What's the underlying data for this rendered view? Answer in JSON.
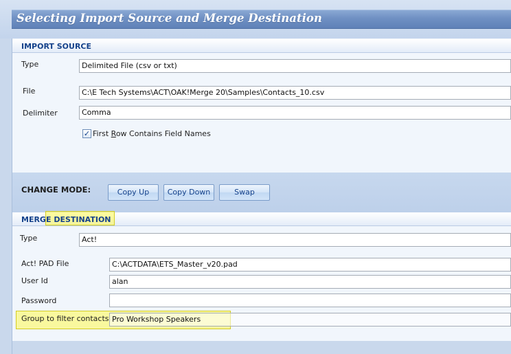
{
  "window": {
    "title": "Selecting Import Source and Merge Destination"
  },
  "import_source": {
    "section_title": "IMPORT SOURCE",
    "type_label": "Type",
    "type_value": "Delimited File (csv or txt)",
    "file_label": "File",
    "file_value": "C:\\E Tech Systems\\ACT\\OAK!Merge 20\\Samples\\Contacts_10.csv",
    "delimiter_label": "Delimiter",
    "delimiter_value": "Comma",
    "first_row_checked": true,
    "first_row_label_prefix": "First ",
    "first_row_label_accel": "R",
    "first_row_label_suffix": "ow Contains Field Names"
  },
  "change_mode": {
    "label": "CHANGE MODE:",
    "copy_up": "Copy Up",
    "copy_down": "Copy Down",
    "swap": "Swap"
  },
  "merge_destination": {
    "title_part1": "MERGE ",
    "title_part2": "DESTINATION",
    "type_label": "Type",
    "type_value": "Act!",
    "pad_file_label": "Act! PAD File",
    "pad_file_value": "C:\\ACTDATA\\ETS_Master_v20.pad",
    "user_id_label": "User Id",
    "user_id_value": "alan",
    "password_label": "Password",
    "password_value": "",
    "group_label": "Group to filter contacts",
    "group_value": "Pro Workshop Speakers"
  },
  "colors": {
    "title_bar": "#6f90c3",
    "section_title": "#15428b",
    "highlight": "#fffa50"
  }
}
